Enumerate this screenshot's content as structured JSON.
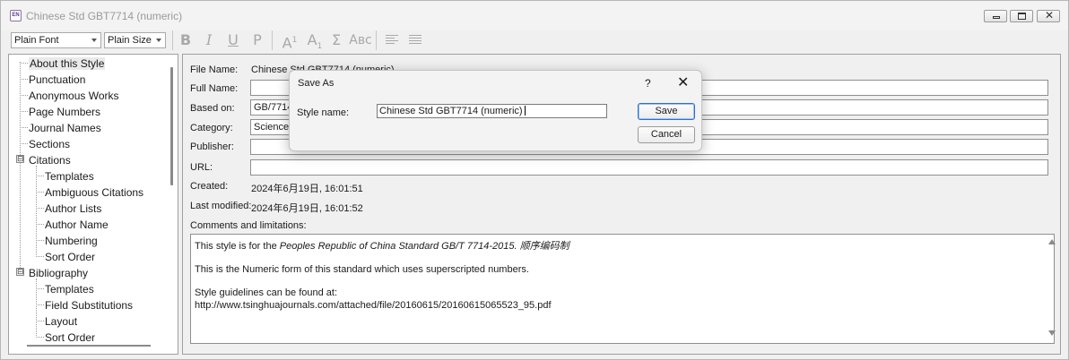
{
  "window": {
    "title": "Chinese Std GBT7714 (numeric)",
    "app_icon_label": "EN",
    "icons": {
      "minimize": "minimize-icon",
      "maximize": "maximize-icon",
      "close": "close-icon"
    },
    "close_glyph": "✕"
  },
  "toolbar": {
    "font_select": "Plain Font",
    "size_select": "Plain Size",
    "bold": "B",
    "italic": "I",
    "underline": "U",
    "plain": "P",
    "superscript_base": "A",
    "superscript_mark": "1",
    "subscript_base": "A",
    "subscript_mark": "1",
    "symbol": "Σ",
    "smallcaps": "Aʙc"
  },
  "tree": {
    "items": [
      {
        "label": "About this Style",
        "selected": true
      },
      {
        "label": "Punctuation"
      },
      {
        "label": "Anonymous Works"
      },
      {
        "label": "Page Numbers"
      },
      {
        "label": "Journal Names"
      },
      {
        "label": "Sections"
      },
      {
        "label": "Citations",
        "expander": "⊟"
      },
      {
        "label": "Templates"
      },
      {
        "label": "Ambiguous Citations"
      },
      {
        "label": "Author Lists"
      },
      {
        "label": "Author Name"
      },
      {
        "label": "Numbering"
      },
      {
        "label": "Sort Order"
      },
      {
        "label": "Bibliography",
        "expander": "⊟"
      },
      {
        "label": "Templates"
      },
      {
        "label": "Field Substitutions"
      },
      {
        "label": "Layout"
      },
      {
        "label": "Sort Order"
      }
    ]
  },
  "details": {
    "file_name_label": "File Name:",
    "file_name_value": "Chinese Std GBT7714 (numeric)",
    "full_name_label": "Full Name:",
    "full_name_value": "",
    "based_on_label": "Based on:",
    "based_on_value": "GB/7714-",
    "category_label": "Category:",
    "category_value": "Science",
    "publisher_label": "Publisher:",
    "publisher_value": "",
    "url_label": "URL:",
    "url_value": "",
    "created_label": "Created:",
    "created_value": "2024年6月19日, 16:01:51",
    "modified_label": "Last modified:",
    "modified_value": "2024年6月19日, 16:01:52",
    "comments_label": "Comments and limitations:",
    "comments": {
      "line1_prefix": "This style is for the ",
      "line1_italic": "Peoples Republic of China Standard GB/T 7714-2015.  顺序编码制",
      "line2": "This is the Numeric form of this standard which uses superscripted numbers.",
      "line3": "Style guidelines can be found at:",
      "line4": "http://www.tsinghuajournals.com/attached/file/20160615/20160615065523_95.pdf"
    }
  },
  "dialog": {
    "title": "Save As",
    "help": "?",
    "close": "✕",
    "style_name_label": "Style name:",
    "style_name_value": "Chinese Std GBT7714 (numeric)",
    "save_button": "Save",
    "cancel_button": "Cancel"
  }
}
